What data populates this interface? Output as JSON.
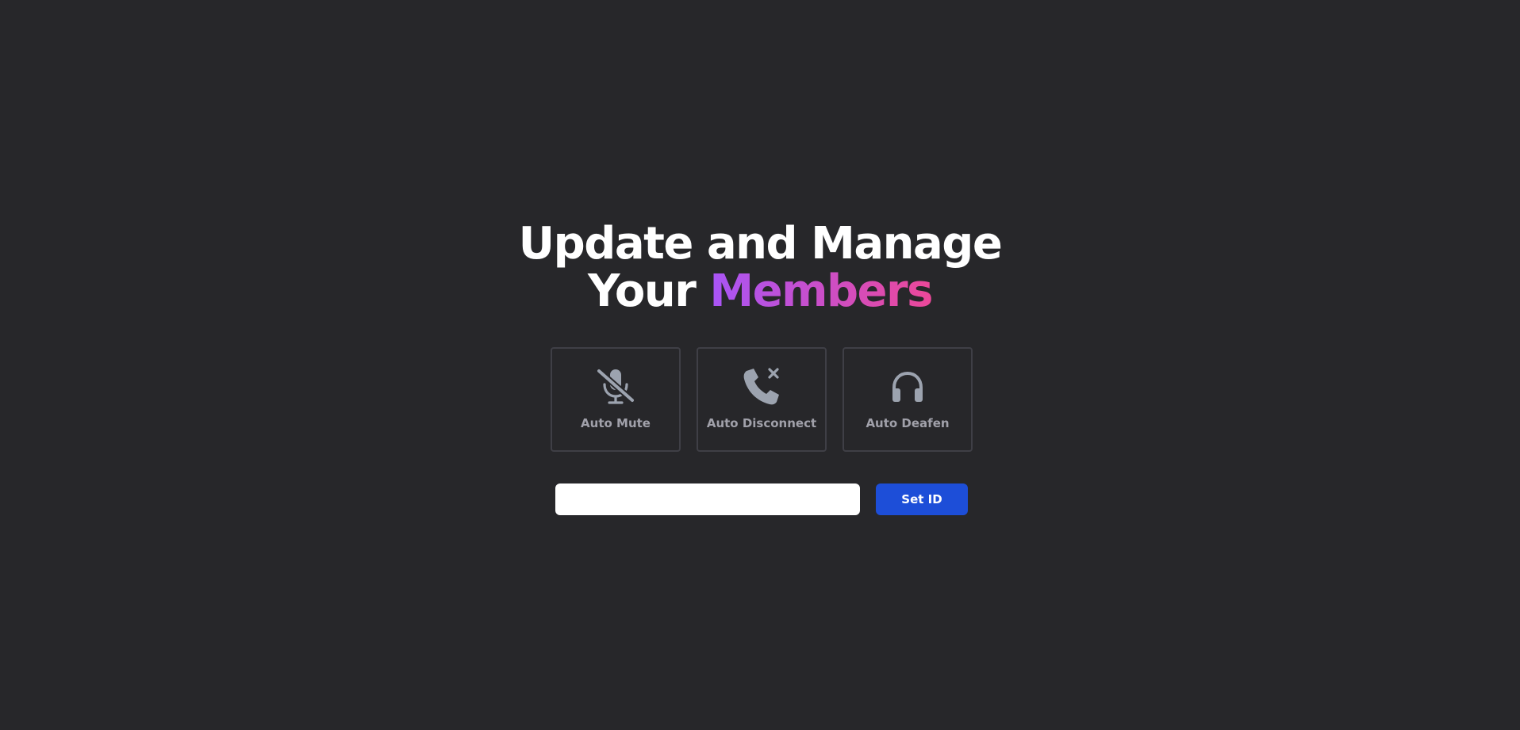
{
  "hero": {
    "line1": "Update and Manage",
    "line2_prefix": "Your ",
    "line2_highlight": "Members",
    "gradient_from": "#a855f7",
    "gradient_to": "#ec4899"
  },
  "features": [
    {
      "label": "Auto Mute",
      "icon": "microphone-off-icon"
    },
    {
      "label": "Auto Disconnect",
      "icon": "phone-x-icon"
    },
    {
      "label": "Auto Deafen",
      "icon": "headphones-icon"
    }
  ],
  "form": {
    "input_value": "",
    "input_placeholder": "",
    "button_label": "Set ID"
  },
  "colors": {
    "background": "#27272a",
    "card_border": "#3f3f46",
    "icon_gray": "#9ca3af",
    "label_gray": "#a1a1aa",
    "button_blue": "#1d4ed8"
  }
}
